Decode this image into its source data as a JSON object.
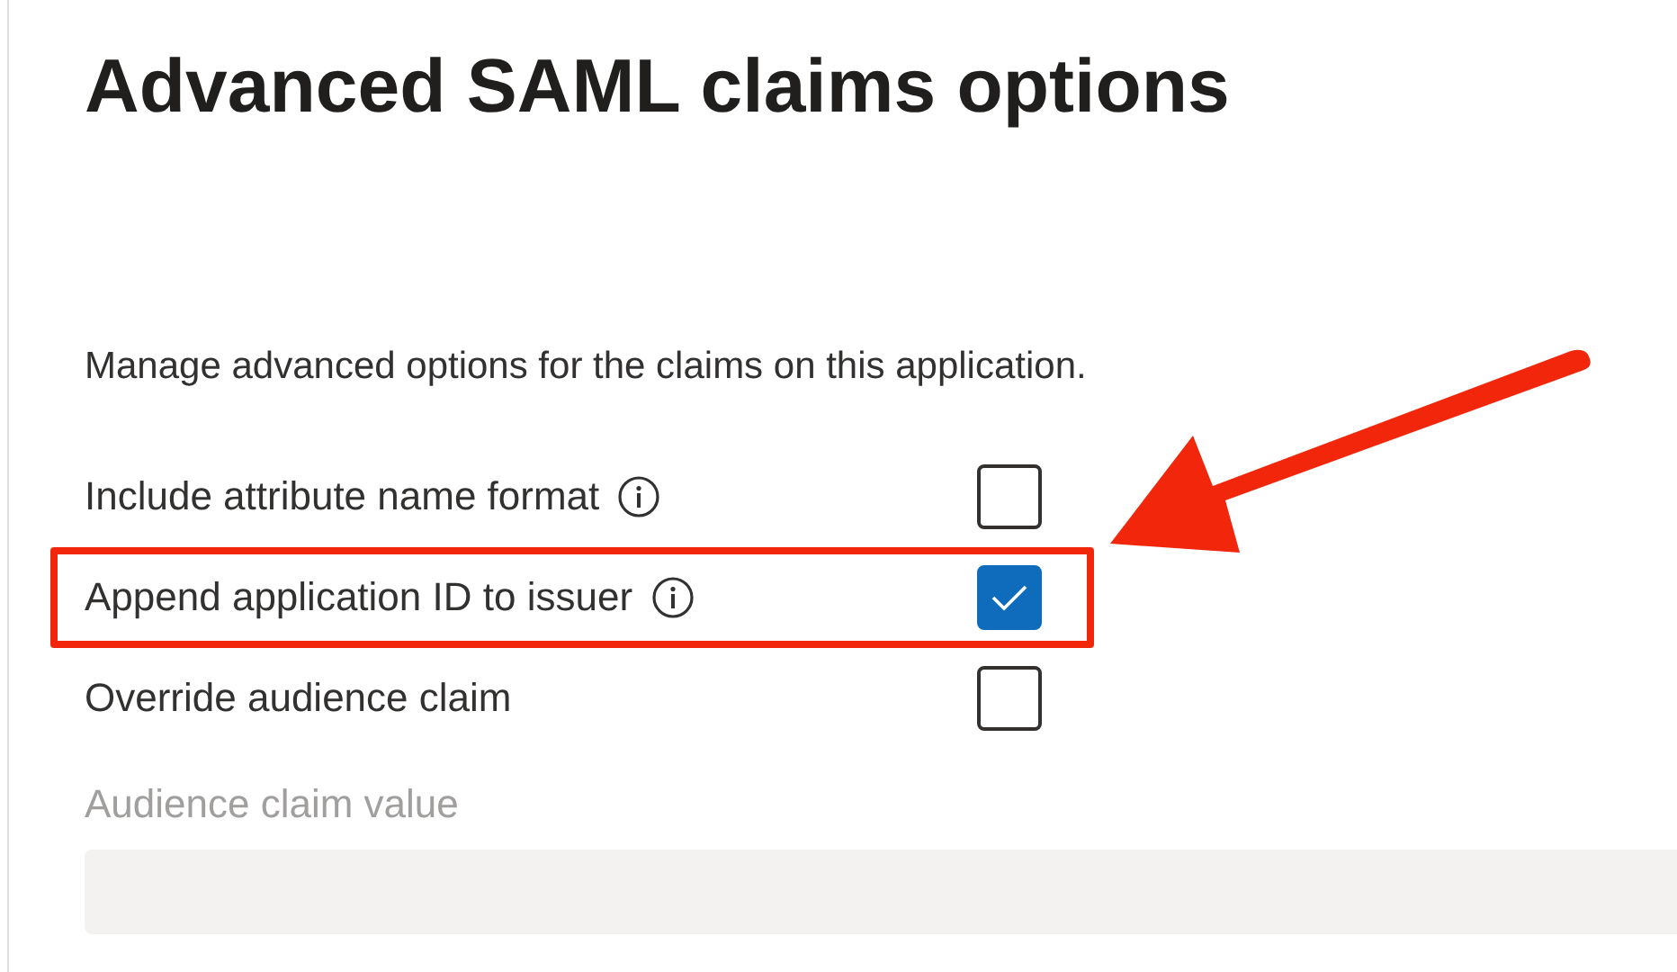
{
  "title": "Advanced SAML claims options",
  "description": "Manage advanced options for the claims on this application.",
  "options": [
    {
      "kind": "checkbox",
      "label": "Include attribute name format",
      "info": true,
      "checked": false,
      "highlighted": false
    },
    {
      "kind": "checkbox",
      "label": "Append application ID to issuer",
      "info": true,
      "checked": true,
      "highlighted": true
    },
    {
      "kind": "checkbox",
      "label": "Override audience claim",
      "info": false,
      "checked": false,
      "highlighted": false
    }
  ],
  "audience_field": {
    "label": "Audience claim value",
    "disabled": true
  }
}
